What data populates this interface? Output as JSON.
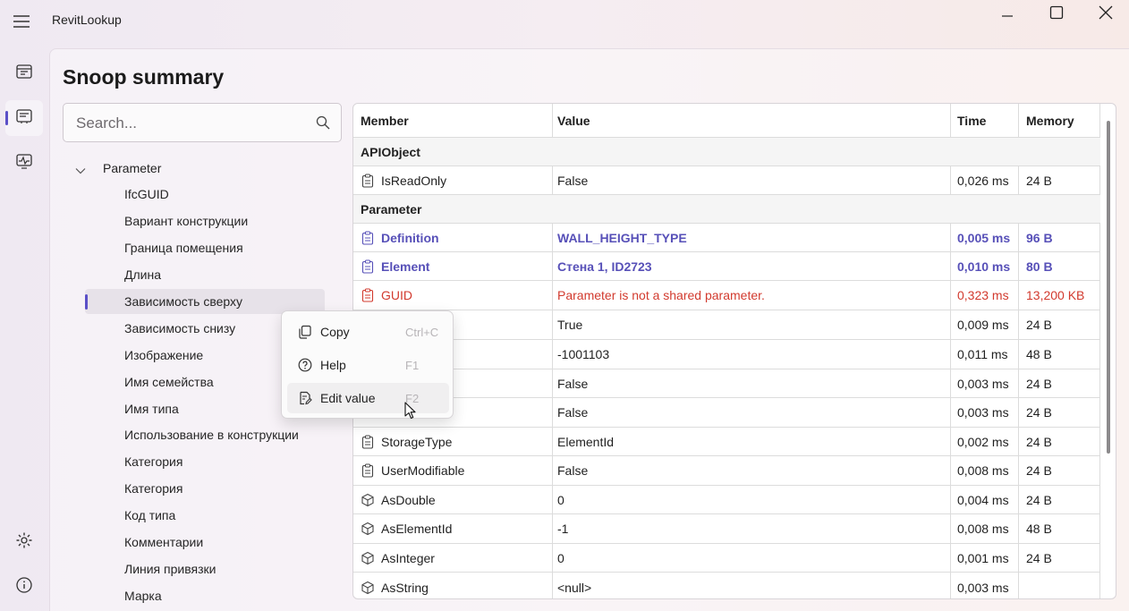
{
  "app": {
    "title": "RevitLookup"
  },
  "nav": {
    "items": [
      {
        "name": "dashboard-icon",
        "active": false
      },
      {
        "name": "snoop-summary-icon",
        "active": true
      },
      {
        "name": "events-monitor-icon",
        "active": false
      },
      {
        "name": "settings-icon",
        "active": false
      },
      {
        "name": "about-icon",
        "active": false
      }
    ]
  },
  "page": {
    "title": "Snoop summary"
  },
  "search": {
    "placeholder": "Search..."
  },
  "tree": {
    "root": "Parameter",
    "items": [
      "IfcGUID",
      "Вариант конструкции",
      "Граница помещения",
      "Длина",
      "Зависимость сверху",
      "Зависимость снизу",
      "Изображение",
      "Имя семейства",
      "Имя типа",
      "Использование в конструкции",
      "Категория",
      "Категория",
      "Код типа",
      "Комментарии",
      "Линия привязки",
      "Марка"
    ],
    "selected_index": 4
  },
  "grid": {
    "columns": {
      "member": "Member",
      "value": "Value",
      "time": "Time",
      "memory": "Memory"
    },
    "groups": {
      "apiobject": "APIObject",
      "parameter": "Parameter"
    },
    "rows": [
      {
        "member": "IsReadOnly",
        "value": "False",
        "time": "0,026 ms",
        "memory": "24 B"
      },
      {
        "member": "Definition",
        "value": "WALL_HEIGHT_TYPE",
        "time": "0,005 ms",
        "memory": "96 B"
      },
      {
        "member": "Element",
        "value": "Стена 1, ID2723",
        "time": "0,010 ms",
        "memory": "80 B"
      },
      {
        "member": "GUID",
        "value": "Parameter is not a shared parameter.",
        "time": "0,323 ms",
        "memory": "13,200 KB"
      },
      {
        "member": "",
        "value": "True",
        "time": "0,009 ms",
        "memory": "24 B"
      },
      {
        "member": "",
        "value": "-1001103",
        "time": "0,011 ms",
        "memory": "48 B"
      },
      {
        "member": "",
        "value": "False",
        "time": "0,003 ms",
        "memory": "24 B"
      },
      {
        "member": "",
        "value": "False",
        "time": "0,003 ms",
        "memory": "24 B"
      },
      {
        "member": "StorageType",
        "value": "ElementId",
        "time": "0,002 ms",
        "memory": "24 B"
      },
      {
        "member": "UserModifiable",
        "value": "False",
        "time": "0,008 ms",
        "memory": "24 B"
      },
      {
        "member": "AsDouble",
        "value": "0",
        "time": "0,004 ms",
        "memory": "24 B"
      },
      {
        "member": "AsElementId",
        "value": "-1",
        "time": "0,008 ms",
        "memory": "48 B"
      },
      {
        "member": "AsInteger",
        "value": "0",
        "time": "0,001 ms",
        "memory": "24 B"
      },
      {
        "member": "AsString",
        "value": "<null>",
        "time": "0,003 ms",
        "memory": ""
      }
    ]
  },
  "context_menu": {
    "copy": {
      "label": "Copy",
      "shortcut": "Ctrl+C"
    },
    "help": {
      "label": "Help",
      "shortcut": "F1"
    },
    "edit": {
      "label": "Edit value",
      "shortcut": "F2"
    }
  },
  "colors": {
    "accent": "#5a4fc7",
    "link": "#5750b8",
    "error": "#d23a2e"
  }
}
